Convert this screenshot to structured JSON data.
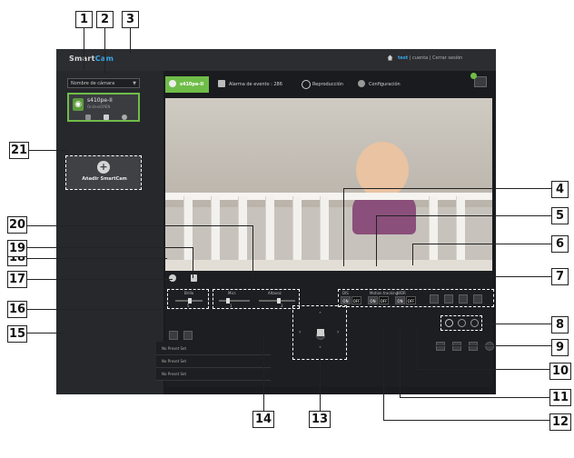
{
  "app": {
    "logo_main": "Smart",
    "logo_accent": "Cam",
    "top_user": "test",
    "top_links": [
      "cuenta",
      "Cerrar sesión"
    ]
  },
  "sidebar": {
    "camera_select_placeholder": "Nombre de cámara",
    "camera_card": {
      "name": "s410pe-II",
      "status": "Online/OPEN"
    },
    "add_label": "Añadir SmartCam"
  },
  "tabs": [
    {
      "label": "s410pe-II",
      "active": true
    },
    {
      "label": "Alarma de evento : 286",
      "active": false
    },
    {
      "label": "Reproducción",
      "active": false
    },
    {
      "label": "Configuración",
      "active": false
    }
  ],
  "sliders": {
    "brightness": "Brillo",
    "mic": "Micr.",
    "speaker": "Altavoz",
    "values": [
      "5",
      "1",
      "3"
    ]
  },
  "toggles": {
    "dis": "DIS",
    "motion": "Motion tracking",
    "wdr": "WDR",
    "on": "ON",
    "off": "OFF"
  },
  "presets": [
    "No Preset Set",
    "No Preset Set",
    "No Preset Set"
  ],
  "callouts": [
    "1",
    "2",
    "3",
    "4",
    "5",
    "6",
    "7",
    "8",
    "9",
    "10",
    "11",
    "12",
    "13",
    "14",
    "15",
    "16",
    "17",
    "18",
    "19",
    "20",
    "21"
  ],
  "colors": {
    "accent_green": "#6fbd48",
    "link_blue": "#39a7e8"
  }
}
